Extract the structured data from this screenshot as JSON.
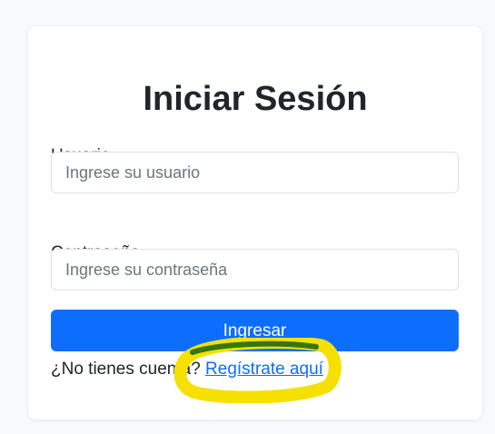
{
  "login": {
    "title": "Iniciar Sesión",
    "username_label": "Usuario",
    "username_placeholder": "Ingrese su usuario",
    "username_value": "",
    "password_label": "Contraseña",
    "password_placeholder": "Ingrese su contraseña",
    "password_value": "",
    "submit_label": "Ingresar",
    "register_prompt": "¿No tienes cuenta?",
    "register_link": "Regístrate aquí"
  },
  "colors": {
    "page_background": "#f8f9fa",
    "card_background": "#ffffff",
    "primary": "#0d6efd",
    "text": "#212529",
    "placeholder": "#6c757d",
    "highlight_mark": "#f5e000",
    "highlight_mark_dark": "#1f6b12"
  }
}
